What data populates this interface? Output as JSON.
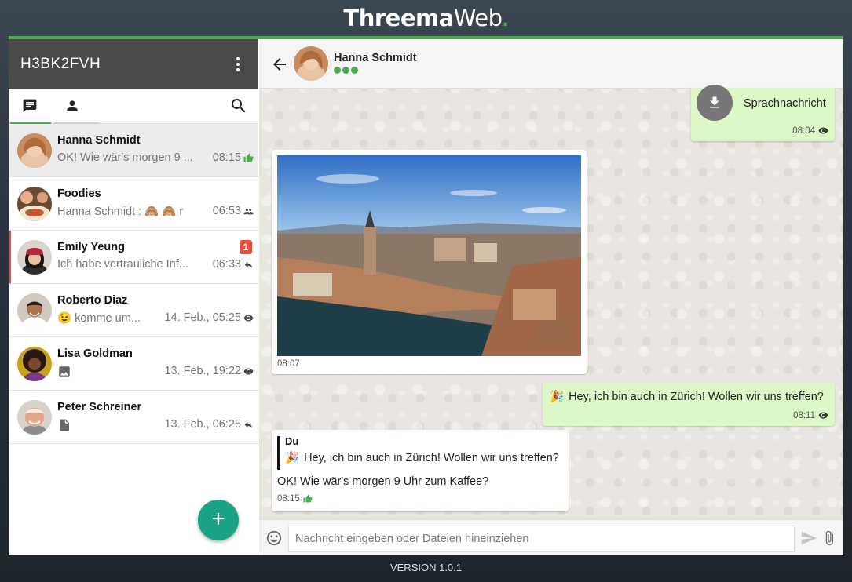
{
  "brand": {
    "part1": "Threema",
    "part2": "Web",
    "dot": ".",
    "accent": "#4cae4f"
  },
  "version": "VERSION 1.0.1",
  "sidebar": {
    "identity": "H3BK2FVH",
    "menu_icon": "more-vert-icon",
    "tabs": [
      {
        "name": "conversations",
        "icon": "chat-list-icon",
        "active": true
      },
      {
        "name": "contacts",
        "icon": "person-icon",
        "active": false
      }
    ],
    "search_icon": "search-icon",
    "conversations": [
      {
        "name": "Hanna Schmidt",
        "snippet": "OK! Wie wär's morgen 9 ...",
        "time": "08:15",
        "status_icon": "thumb-up-icon",
        "selected": true,
        "unread": null
      },
      {
        "name": "Foodies",
        "snippet": "Hanna Schmidt : 🙈 🙈 r",
        "time": "06:53",
        "status_icon": "group-icon",
        "selected": false,
        "unread": null
      },
      {
        "name": "Emily Yeung",
        "snippet": "Ich habe vertrauliche Inf...",
        "time": "06:33",
        "status_icon": "reply-icon",
        "selected": false,
        "unread": "1"
      },
      {
        "name": "Roberto Diaz",
        "snippet": "😉 komme um...",
        "time": "14. Feb., 05:25",
        "status_icon": "eye-icon",
        "selected": false,
        "unread": null
      },
      {
        "name": "Lisa Goldman",
        "snippet": "",
        "time": "13. Feb., 19:22",
        "status_icon": "eye-icon",
        "snippet_icon": "image-icon",
        "selected": false,
        "unread": null
      },
      {
        "name": "Peter Schreiner",
        "snippet": "",
        "time": "13. Feb., 06:25",
        "status_icon": "reply-icon",
        "snippet_icon": "file-icon",
        "selected": false,
        "unread": null
      }
    ],
    "fab_label": "+"
  },
  "chat": {
    "contact_name": "Hanna Schmidt",
    "verification_level": 3,
    "messages": [
      {
        "type": "voice",
        "direction": "out",
        "label": "Sprachnachricht",
        "time": "08:04",
        "status_icon": "eye-icon"
      },
      {
        "type": "image",
        "direction": "in",
        "time": "08:07"
      },
      {
        "type": "text",
        "direction": "out",
        "emoji": "🎉",
        "text": "Hey, ich bin auch in Zürich! Wollen wir uns treffen?",
        "time": "08:11",
        "status_icon": "eye-icon"
      },
      {
        "type": "quote",
        "direction": "in",
        "quote_author": "Du",
        "quote_emoji": "🎉",
        "quote_text": "Hey, ich bin auch in Zürich! Wollen wir uns treffen?",
        "text": "OK! Wie wär's morgen 9 Uhr zum Kaffee?",
        "time": "08:15",
        "status_icon": "thumb-up-icon"
      }
    ],
    "composer": {
      "placeholder": "Nachricht eingeben oder Dateien hineinziehen"
    }
  },
  "colors": {
    "accent": "#4cae4f",
    "header_dark": "#4a4a4a",
    "fab": "#1aa385",
    "unread": "#e84c3d",
    "bubble_out": "#dcf8c6"
  }
}
